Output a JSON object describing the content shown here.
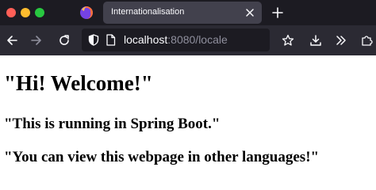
{
  "tab": {
    "title": "Internationalisation"
  },
  "url": {
    "host": "localhost",
    "rest": ":8080/locale"
  },
  "page": {
    "heading": "\"Hi! Welcome!\"",
    "line1": "\"This is running in Spring Boot.\"",
    "line2": "\"You can view this webpage in other languages!\""
  },
  "icons": {
    "browser_logo": "firefox-icon",
    "tab_close": "close-icon",
    "new_tab": "plus-icon",
    "back": "arrow-left-icon",
    "forward": "arrow-right-icon",
    "reload": "reload-icon",
    "tracking_protection": "shield-icon",
    "page_info": "page-icon",
    "bookmark": "star-icon",
    "downloads": "download-icon",
    "more_tools": "chevron-double-right-icon",
    "extensions": "puzzle-icon"
  },
  "colors": {
    "tab_strip_bg": "#1c1b22",
    "toolbar_bg": "#2b2a33",
    "active_tab_bg": "#42414d",
    "close_dot": "#ff5f57",
    "minimize_dot": "#febc2e",
    "zoom_dot": "#28c840"
  }
}
